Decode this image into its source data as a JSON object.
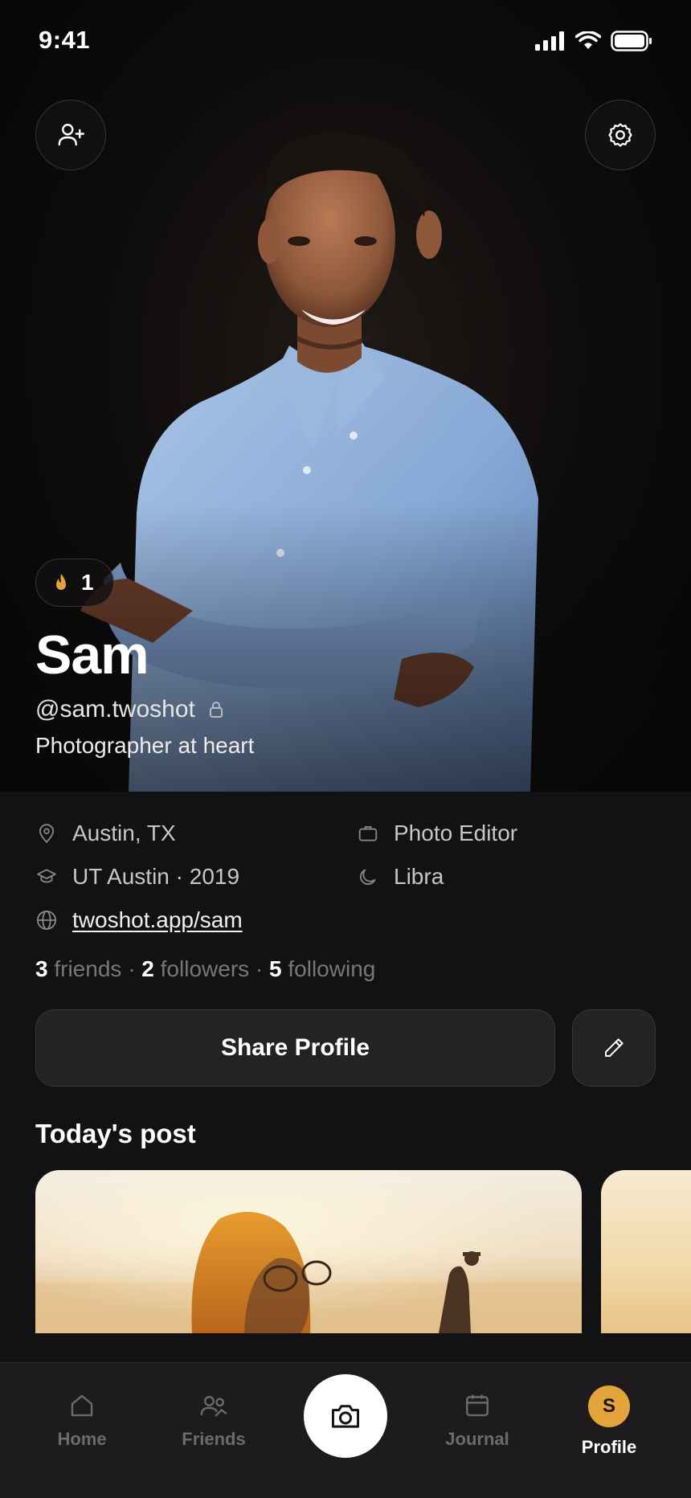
{
  "status_bar": {
    "time": "9:41"
  },
  "profile": {
    "name": "Sam",
    "handle": "@sam.twoshot",
    "bio": "Photographer at heart",
    "streak_count": "1"
  },
  "details": {
    "location": "Austin, TX",
    "job": "Photo Editor",
    "education": "UT Austin · 2019",
    "zodiac": "Libra",
    "website": "twoshot.app/sam"
  },
  "stats": {
    "friends_count": "3",
    "friends_label": "friends",
    "followers_count": "2",
    "followers_label": "followers",
    "following_count": "5",
    "following_label": "following",
    "separator": "·"
  },
  "actions": {
    "share_label": "Share Profile"
  },
  "todays_post": {
    "title": "Today's post"
  },
  "tab_bar": {
    "items": [
      {
        "label": "Home",
        "icon": "home-icon"
      },
      {
        "label": "Friends",
        "icon": "friends-icon"
      },
      {
        "label": "",
        "icon": "camera-icon"
      },
      {
        "label": "Journal",
        "icon": "journal-icon"
      },
      {
        "label": "Profile",
        "icon": "avatar",
        "avatar_initial": "S"
      }
    ],
    "active": "Profile"
  },
  "colors": {
    "accent": "#E2A43B",
    "background": "#121114",
    "card": "#252224"
  }
}
